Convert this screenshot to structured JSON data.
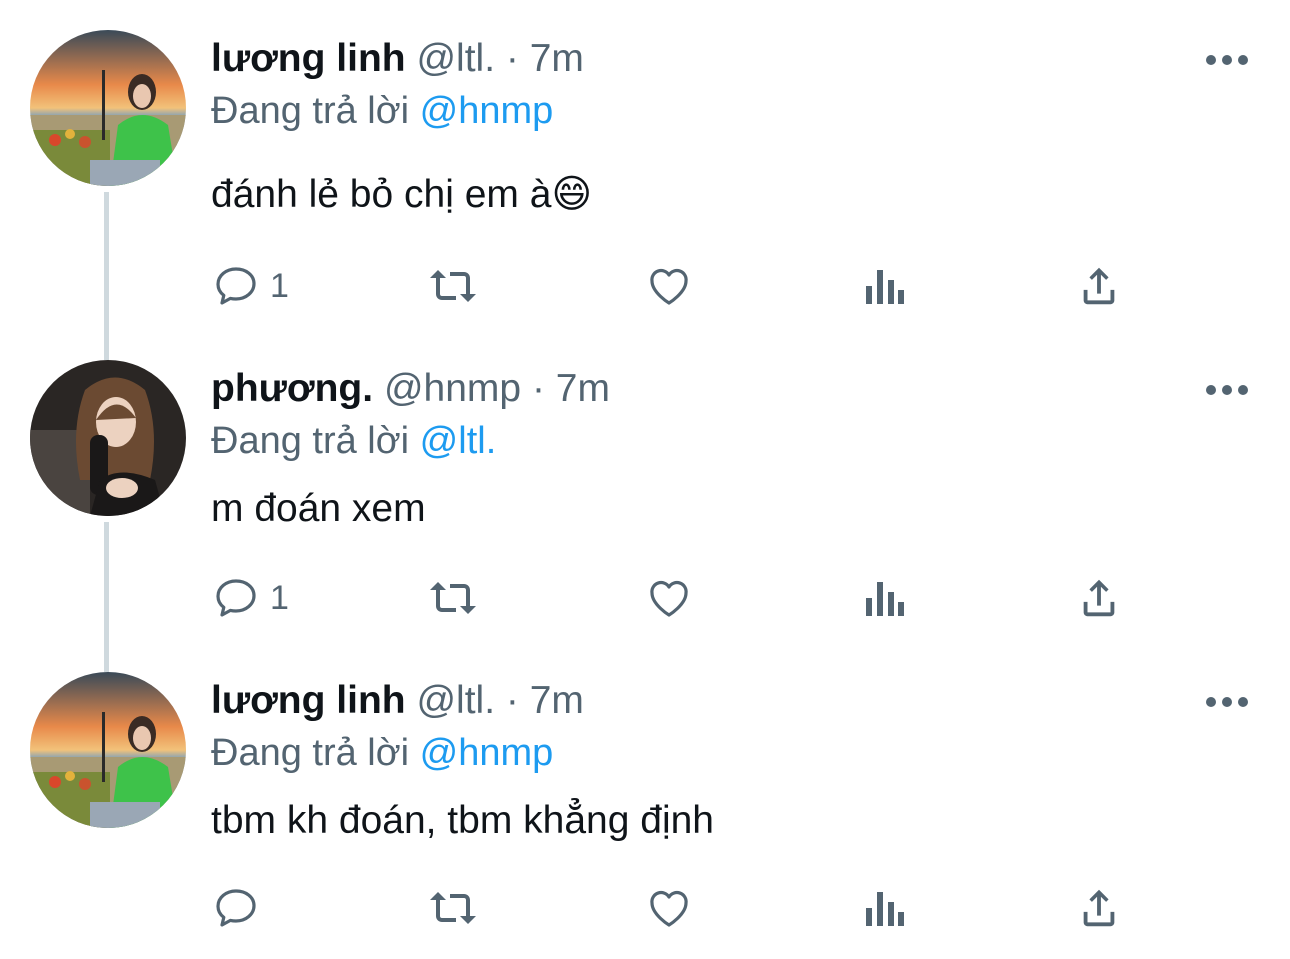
{
  "tweets": [
    {
      "display_name": "lương linh",
      "handle": "@ltl.",
      "separator": "·",
      "time": "7m",
      "reply_prefix": "Đang trả lời",
      "reply_to": "@hnmp",
      "text": "đánh lẻ bỏ chị em à😄",
      "reply_count": "1",
      "avatar_icon": "profile-photo-sunset-beach"
    },
    {
      "display_name": "phương.",
      "handle": "@hnmp",
      "separator": "·",
      "time": "7m",
      "reply_prefix": "Đang trả lời",
      "reply_to": "@ltl.",
      "text": "m đoán xem",
      "reply_count": "1",
      "avatar_icon": "profile-photo-portrait"
    },
    {
      "display_name": "lương linh",
      "handle": "@ltl.",
      "separator": "·",
      "time": "7m",
      "reply_prefix": "Đang trả lời",
      "reply_to": "@hnmp",
      "text": "tbm kh đoán, tbm khẳng định",
      "reply_count": "",
      "avatar_icon": "profile-photo-sunset-beach"
    }
  ],
  "icons": {
    "reply": "comment-icon",
    "retweet": "retweet-icon",
    "like": "heart-icon",
    "views": "bar-chart-icon",
    "share": "share-icon",
    "more": "more-icon"
  },
  "colors": {
    "text": "#0f1419",
    "secondary": "#536471",
    "accent": "#1d9bf0",
    "thread_line": "#cfd9de"
  }
}
